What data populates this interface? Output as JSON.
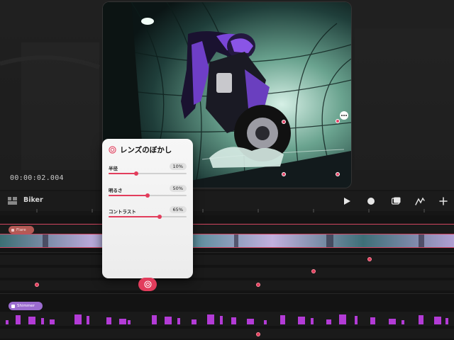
{
  "viewer": {
    "timecode": "00:00:02.004"
  },
  "toolbar": {
    "project_name": "Biker",
    "icons": [
      "panels-icon",
      "play-icon",
      "record-icon",
      "layers-icon",
      "draw-icon",
      "add-icon"
    ]
  },
  "timeline": {
    "tracks": {
      "flare_label": "Flare",
      "shimmer_label": "Shimmer"
    },
    "accent_color": "#e23d5c",
    "shimmer_color": "#b33bd6"
  },
  "lens_blur_panel": {
    "title": "レンズのぼかし",
    "params": [
      {
        "label": "半径",
        "value_text": "10%",
        "value": 0.35
      },
      {
        "label": "明るさ",
        "value_text": "50%",
        "value": 0.5
      },
      {
        "label": "コントラスト",
        "value_text": "65%",
        "value": 0.65
      }
    ]
  }
}
